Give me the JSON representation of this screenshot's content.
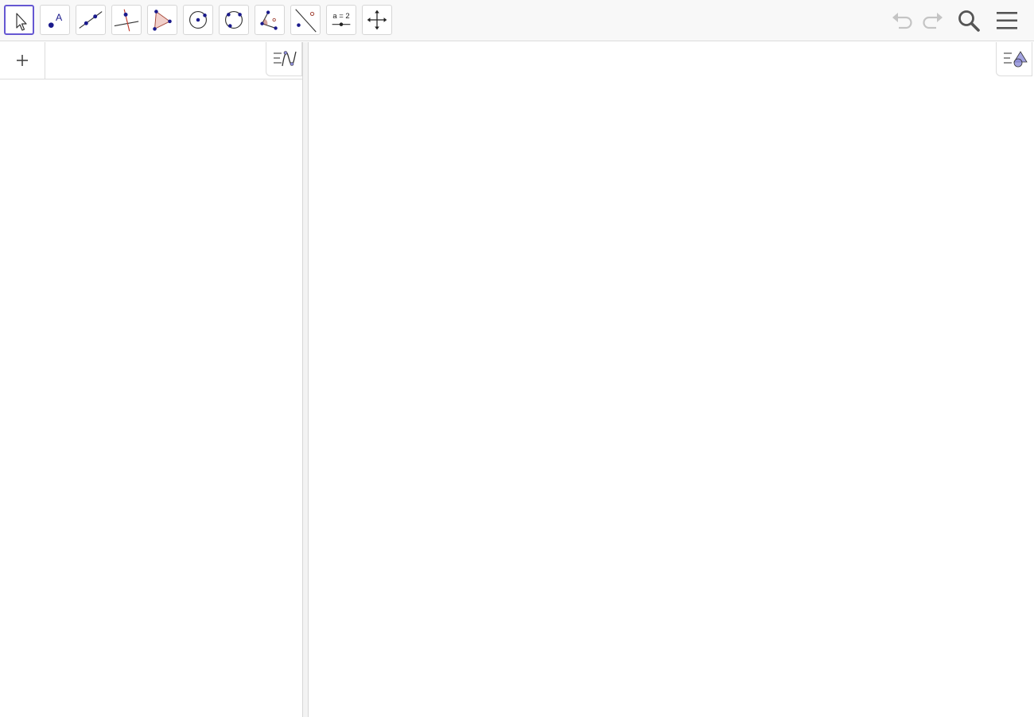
{
  "app": {
    "accent": "#6557d2"
  },
  "toolbar": {
    "tools": [
      {
        "name": "move",
        "icon": "move-arrow-icon",
        "selected": true
      },
      {
        "name": "point",
        "icon": "point-icon",
        "label": "A"
      },
      {
        "name": "line",
        "icon": "line-through-points-icon"
      },
      {
        "name": "perpendicular-line",
        "icon": "perpendicular-line-icon"
      },
      {
        "name": "polygon",
        "icon": "polygon-icon"
      },
      {
        "name": "circle-center-point",
        "icon": "circle-center-icon"
      },
      {
        "name": "circle-three-points",
        "icon": "circle-three-points-icon"
      },
      {
        "name": "angle",
        "icon": "angle-icon"
      },
      {
        "name": "reflect-about-line",
        "icon": "reflect-line-icon"
      },
      {
        "name": "slider",
        "icon": "slider-icon",
        "label": "a = 2"
      },
      {
        "name": "move-graphics-view",
        "icon": "move-view-icon"
      }
    ],
    "right": {
      "undo_icon": "undo-icon",
      "redo_icon": "redo-icon",
      "search_icon": "search-icon",
      "menu_icon": "hamburger-menu-icon"
    }
  },
  "algebra": {
    "add_icon": "plus-icon",
    "input_value": "",
    "input_placeholder": "",
    "style_bar_icon": "algebra-style-bar-icon"
  },
  "graphics": {
    "style_bar_icon": "graphics-style-bar-icon"
  }
}
